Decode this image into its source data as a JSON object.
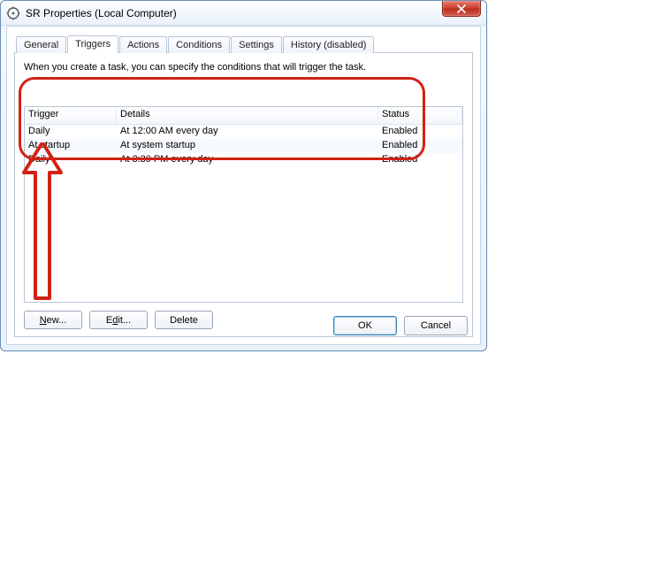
{
  "window": {
    "title": "SR Properties (Local Computer)"
  },
  "tabs": {
    "general": "General",
    "triggers": "Triggers",
    "actions": "Actions",
    "conditions": "Conditions",
    "settings": "Settings",
    "history": "History (disabled)"
  },
  "description": "When you create a task, you can specify the conditions that will trigger the task.",
  "columns": {
    "trigger": "Trigger",
    "details": "Details",
    "status": "Status"
  },
  "rows": [
    {
      "trigger": "Daily",
      "details": "At 12:00 AM every day",
      "status": "Enabled"
    },
    {
      "trigger": "At startup",
      "details": "At system startup",
      "status": "Enabled"
    },
    {
      "trigger": "Daily",
      "details": "At 3:30 PM every day",
      "status": "Enabled"
    }
  ],
  "buttons": {
    "new": "New...",
    "edit": "Edit...",
    "delete": "Delete",
    "ok": "OK",
    "cancel": "Cancel"
  }
}
